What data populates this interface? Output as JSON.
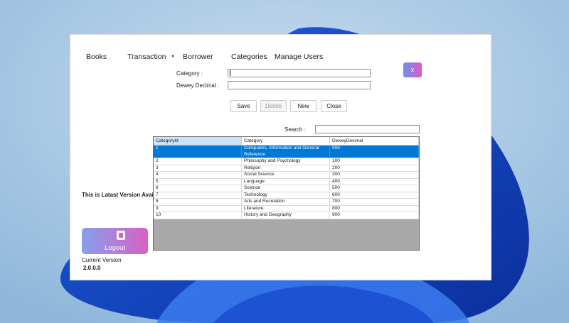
{
  "menu": {
    "books": "Books",
    "transaction": "Transaction",
    "transaction_arrow": "▾",
    "borrower": "Borrower",
    "categories": "Categories",
    "manage_users": "Manage Users"
  },
  "close_button": "x",
  "form": {
    "category_label": "Category :",
    "category_value": "",
    "dewey_label": "Dewey Decimal :",
    "dewey_value": ""
  },
  "buttons": {
    "save": "Save",
    "delete": "Delete",
    "new": "New",
    "close": "Close"
  },
  "search": {
    "label": "Search :",
    "value": ""
  },
  "grid": {
    "columns": [
      "CategoryId",
      "Category",
      "DeweyDecimal"
    ],
    "rows": [
      [
        "1",
        "Computers, Information and General Reference",
        "000"
      ],
      [
        "2",
        "Philosophy and Psychology",
        "100"
      ],
      [
        "3",
        "Religion",
        "200"
      ],
      [
        "4",
        "Social Science",
        "300"
      ],
      [
        "5",
        "Language",
        "400"
      ],
      [
        "6",
        "Science",
        "500"
      ],
      [
        "7",
        "Technology",
        "600"
      ],
      [
        "8",
        "Arts and Recreation",
        "700"
      ],
      [
        "9",
        "Literature",
        "800"
      ],
      [
        "10",
        "History and Geography",
        "900"
      ]
    ],
    "selected_row": 0
  },
  "sidebar": {
    "notice": "This is Latast Version Avai",
    "logout_label": "Logout",
    "logout_icon": "logout-icon",
    "version_label": "Current Version",
    "version_value": "2.0.0.0"
  },
  "colors": {
    "accent_start": "#6f8ef0",
    "accent_end": "#e35ac1",
    "selection": "#0078d7"
  }
}
